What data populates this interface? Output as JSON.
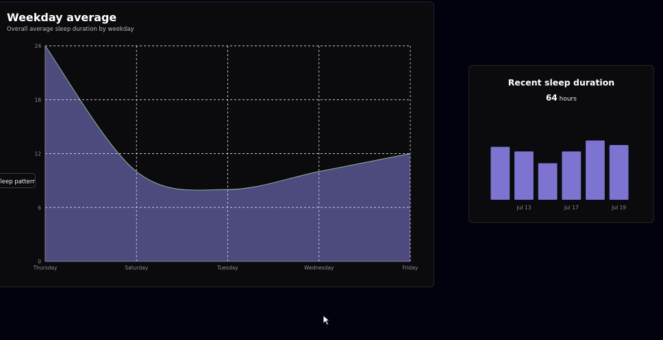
{
  "weekday_card": {
    "title": "Weekday average",
    "subtitle": "Overall average sleep duration by weekday",
    "pattern_button": "Sleep pattern"
  },
  "recent_card": {
    "title": "Recent sleep duration",
    "total_value": "64",
    "total_unit": "hours"
  },
  "colors": {
    "area_fill": "#4d4a7e",
    "area_line": "#8fb99e",
    "bar_fill": "#7d74d1",
    "grid": "#cfcfd6"
  },
  "chart_data": [
    {
      "type": "area",
      "categories": [
        "Thursday",
        "Saturday",
        "Tuesday",
        "Wednesday",
        "Friday"
      ],
      "values": [
        24,
        10,
        8,
        10,
        12
      ],
      "yticks": [
        0,
        6,
        12,
        18,
        24
      ],
      "ylim": [
        0,
        24
      ],
      "grid": true,
      "title": "",
      "xlabel": "",
      "ylabel": ""
    },
    {
      "type": "bar",
      "values": [
        5.8,
        5.3,
        4.0,
        5.3,
        6.5,
        6.0
      ],
      "xtick_labels": [
        "Jul 13",
        "Jul 17",
        "Jul 19"
      ],
      "xtick_bar_index": [
        1,
        3,
        5
      ],
      "ylim": [
        0,
        7.5
      ],
      "grid": false
    }
  ]
}
